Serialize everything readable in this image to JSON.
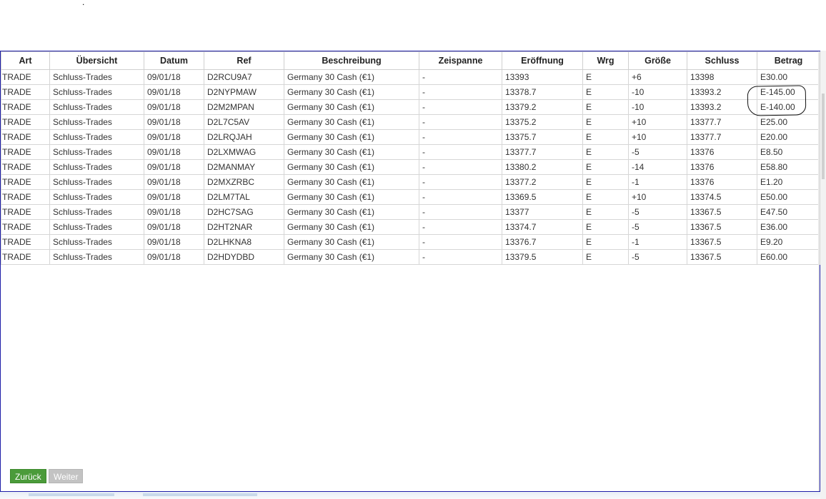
{
  "top_mark": ".",
  "table": {
    "headers": [
      "Art",
      "Übersicht",
      "Datum",
      "Ref",
      "Beschreibung",
      "Zeispanne",
      "Eröffnung",
      "Wrg",
      "Größe",
      "Schluss",
      "Betrag"
    ],
    "rows": [
      [
        "TRADE",
        "Schluss-Trades",
        "09/01/18",
        "D2RCU9A7",
        "Germany 30 Cash (€1)",
        "-",
        "13393",
        "E",
        "+6",
        "13398",
        "E30.00"
      ],
      [
        "TRADE",
        "Schluss-Trades",
        "09/01/18",
        "D2NYPMAW",
        "Germany 30 Cash (€1)",
        "-",
        "13378.7",
        "E",
        "-10",
        "13393.2",
        "E-145.00"
      ],
      [
        "TRADE",
        "Schluss-Trades",
        "09/01/18",
        "D2M2MPAN",
        "Germany 30 Cash (€1)",
        "-",
        "13379.2",
        "E",
        "-10",
        "13393.2",
        "E-140.00"
      ],
      [
        "TRADE",
        "Schluss-Trades",
        "09/01/18",
        "D2L7C5AV",
        "Germany 30 Cash (€1)",
        "-",
        "13375.2",
        "E",
        "+10",
        "13377.7",
        "E25.00"
      ],
      [
        "TRADE",
        "Schluss-Trades",
        "09/01/18",
        "D2LRQJAH",
        "Germany 30 Cash (€1)",
        "-",
        "13375.7",
        "E",
        "+10",
        "13377.7",
        "E20.00"
      ],
      [
        "TRADE",
        "Schluss-Trades",
        "09/01/18",
        "D2LXMWAG",
        "Germany 30 Cash (€1)",
        "-",
        "13377.7",
        "E",
        "-5",
        "13376",
        "E8.50"
      ],
      [
        "TRADE",
        "Schluss-Trades",
        "09/01/18",
        "D2MANMAY",
        "Germany 30 Cash (€1)",
        "-",
        "13380.2",
        "E",
        "-14",
        "13376",
        "E58.80"
      ],
      [
        "TRADE",
        "Schluss-Trades",
        "09/01/18",
        "D2MXZRBC",
        "Germany 30 Cash (€1)",
        "-",
        "13377.2",
        "E",
        "-1",
        "13376",
        "E1.20"
      ],
      [
        "TRADE",
        "Schluss-Trades",
        "09/01/18",
        "D2LM7TAL",
        "Germany 30 Cash (€1)",
        "-",
        "13369.5",
        "E",
        "+10",
        "13374.5",
        "E50.00"
      ],
      [
        "TRADE",
        "Schluss-Trades",
        "09/01/18",
        "D2HC7SAG",
        "Germany 30 Cash (€1)",
        "-",
        "13377",
        "E",
        "-5",
        "13367.5",
        "E47.50"
      ],
      [
        "TRADE",
        "Schluss-Trades",
        "09/01/18",
        "D2HT2NAR",
        "Germany 30 Cash (€1)",
        "-",
        "13374.7",
        "E",
        "-5",
        "13367.5",
        "E36.00"
      ],
      [
        "TRADE",
        "Schluss-Trades",
        "09/01/18",
        "D2LHKNA8",
        "Germany 30 Cash (€1)",
        "-",
        "13376.7",
        "E",
        "-1",
        "13367.5",
        "E9.20"
      ],
      [
        "TRADE",
        "Schluss-Trades",
        "09/01/18",
        "D2HDYDBD",
        "Germany 30 Cash (€1)",
        "-",
        "13379.5",
        "E",
        "-5",
        "13367.5",
        "E60.00"
      ]
    ]
  },
  "buttons": {
    "back_label": "Zurück",
    "next_label": "Weiter"
  },
  "colors": {
    "panel_border": "#1e1ea8",
    "back_button": "#4b9b3a",
    "next_button_disabled": "#c3c3c3"
  }
}
